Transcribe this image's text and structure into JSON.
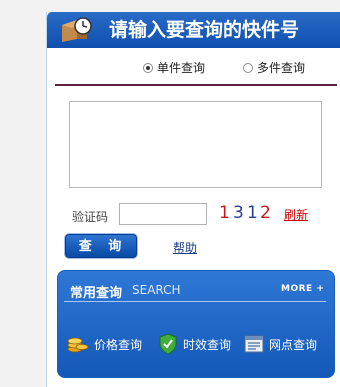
{
  "header": {
    "title": "请输入要查询的快件号"
  },
  "mode": {
    "single_label": "单件查询",
    "multi_label": "多件查询"
  },
  "captcha": {
    "label": "验证码",
    "code": "1312",
    "refresh_label": "刷新"
  },
  "actions": {
    "query_label": "查 询",
    "help_label": "帮助"
  },
  "common": {
    "title": "常用查询",
    "subtitle": "SEARCH",
    "more_label": "MORE +",
    "items": [
      {
        "label": "价格查询",
        "icon": "coins-icon"
      },
      {
        "label": "时效查询",
        "icon": "shield-check-icon"
      },
      {
        "label": "网点查询",
        "icon": "outlet-list-icon"
      }
    ]
  },
  "colors": {
    "header_blue": "#1553b5",
    "divider": "#5b2244",
    "refresh_red": "#cc0000",
    "help_link": "#1a3c8a"
  }
}
